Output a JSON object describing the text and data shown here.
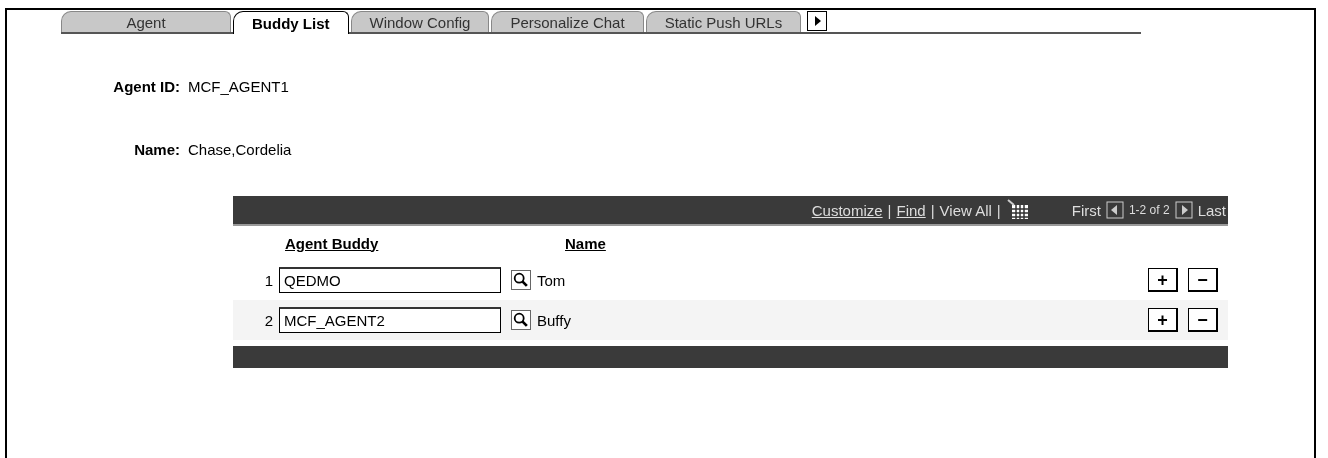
{
  "tabs": [
    {
      "label": "Agent",
      "selected": false
    },
    {
      "label": "Buddy List",
      "selected": true
    },
    {
      "label": "Window Config",
      "selected": false
    },
    {
      "label": "Personalize Chat",
      "selected": false
    },
    {
      "label": "Static Push URLs",
      "selected": false
    }
  ],
  "fields": [
    {
      "label": "Agent ID:",
      "value": "MCF_AGENT1"
    },
    {
      "label": "Name:",
      "value": "Chase,Cordelia"
    }
  ],
  "grid": {
    "header_items": [
      {
        "kind": "link",
        "text": "Customize"
      },
      {
        "kind": "separator",
        "text": "|"
      },
      {
        "kind": "link",
        "text": "Find"
      },
      {
        "kind": "separator",
        "text": "|"
      },
      {
        "kind": "text",
        "text": "View All"
      },
      {
        "kind": "separator",
        "text": "|"
      }
    ],
    "first": "First",
    "range": "1-2 of 2",
    "last": "Last",
    "columns": [
      "Agent Buddy",
      "Name"
    ],
    "rows": [
      {
        "number": "1",
        "agent_buddy": "QEDMO",
        "name": "Tom"
      },
      {
        "number": "2",
        "agent_buddy": "MCF_AGENT2",
        "name": "Buffy"
      }
    ],
    "add_label": "+",
    "remove_label": "−"
  }
}
